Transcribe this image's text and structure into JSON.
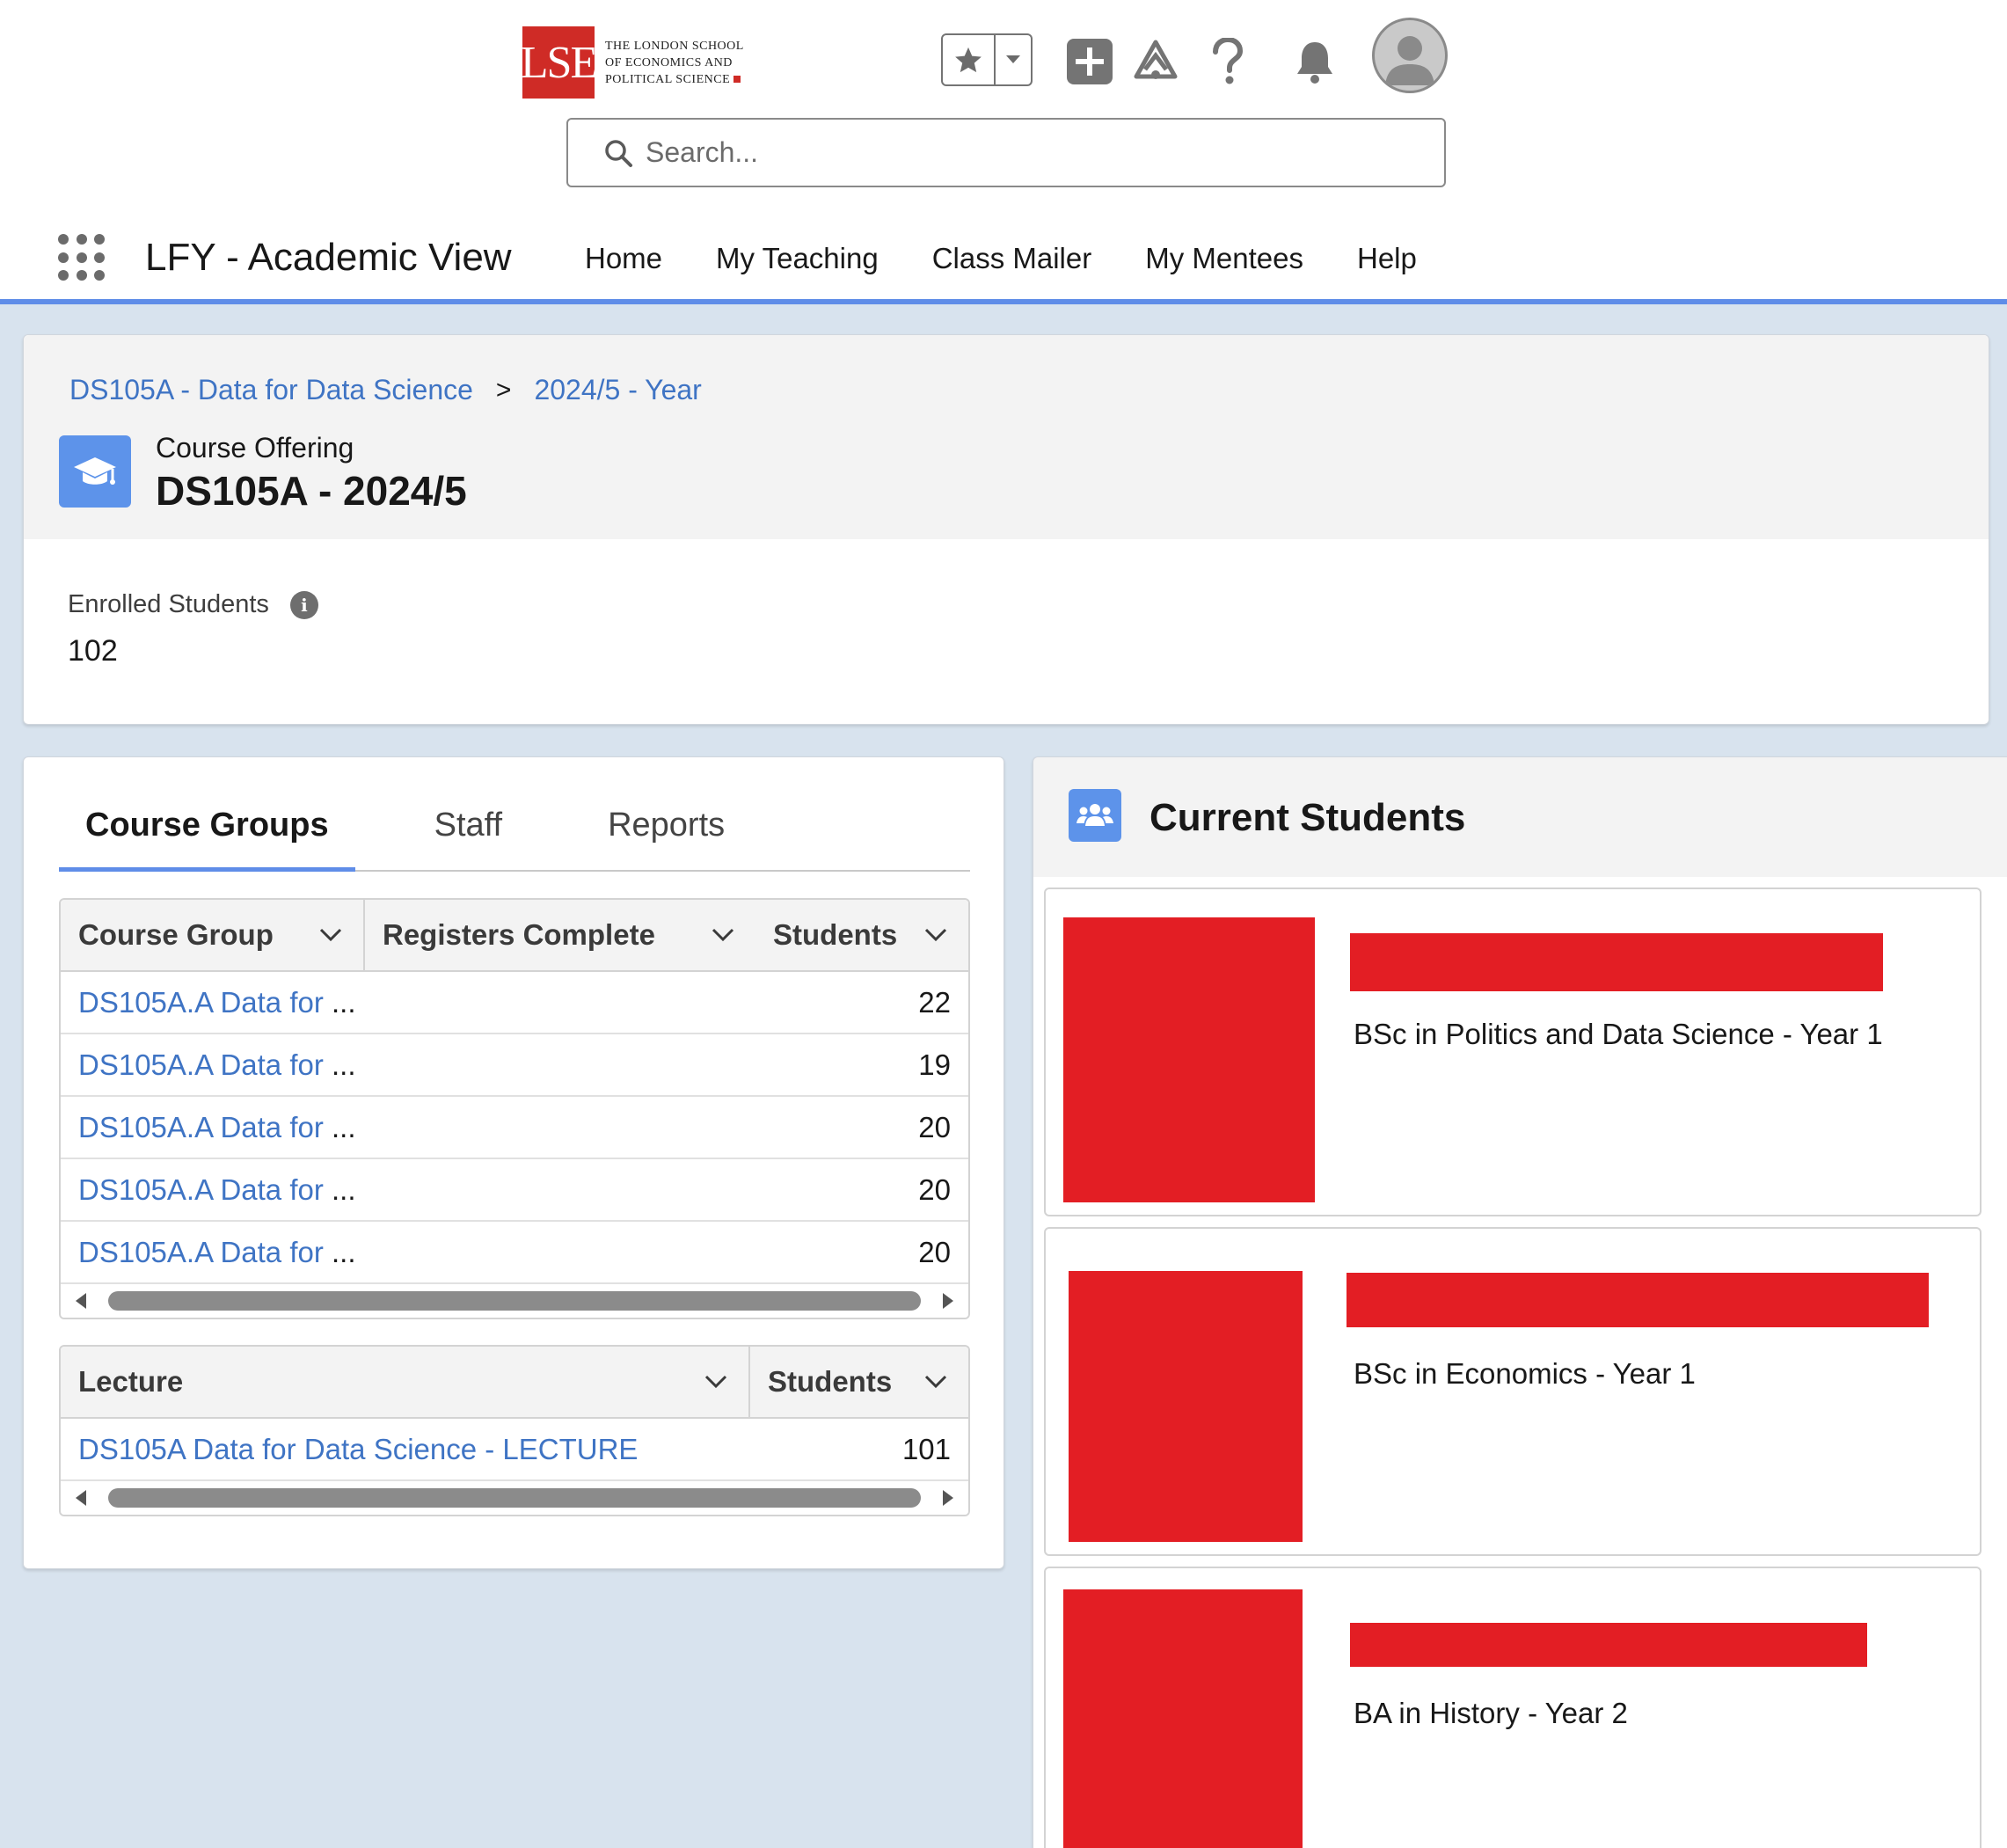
{
  "brand": {
    "logo_mark": "LSE",
    "logo_lines": [
      "The London School",
      "of Economics and",
      "Political Science"
    ]
  },
  "header": {
    "search_placeholder": "Search...",
    "icons": [
      "star-icon",
      "chevron-down-icon",
      "add-icon",
      "setup-trailhead-icon",
      "help-icon",
      "notification-bell-icon",
      "avatar-icon"
    ]
  },
  "app": {
    "name": "LFY - Academic View",
    "nav": [
      "Home",
      "My Teaching",
      "Class Mailer",
      "My Mentees",
      "Help"
    ]
  },
  "record": {
    "breadcrumb": [
      "DS105A - Data for Data Science",
      "2024/5 - Year"
    ],
    "breadcrumb_sep": ">",
    "type": "Course Offering",
    "title": "DS105A - 2024/5",
    "field_label": "Enrolled Students",
    "field_value": "102"
  },
  "tabs": [
    "Course Groups",
    "Staff",
    "Reports"
  ],
  "course_groups_table": {
    "headers": [
      "Course Group",
      "Registers Complete",
      "Students"
    ],
    "rows": [
      {
        "name": "DS105A.A Data for",
        "ellipsis": "...",
        "students": "22"
      },
      {
        "name": "DS105A.A Data for",
        "ellipsis": "...",
        "students": "19"
      },
      {
        "name": "DS105A.A Data for",
        "ellipsis": "...",
        "students": "20"
      },
      {
        "name": "DS105A.A Data for",
        "ellipsis": "...",
        "students": "20"
      },
      {
        "name": "DS105A.A Data for",
        "ellipsis": "...",
        "students": "20"
      }
    ]
  },
  "lecture_table": {
    "headers": [
      "Lecture",
      "Students"
    ],
    "rows": [
      {
        "name": "DS105A Data for Data Science - LECTURE",
        "students": "101"
      }
    ]
  },
  "current_students": {
    "title": "Current Students",
    "students": [
      {
        "programme": "BSc in Politics and Data Science - Year 1"
      },
      {
        "programme": "BSc in Economics - Year 1"
      },
      {
        "programme": "BA in History - Year 2"
      }
    ]
  },
  "colors": {
    "accent": "#5f8de8",
    "link": "#3f74c4",
    "redaction": "#e31e24",
    "lse_red": "#cf2b26"
  }
}
